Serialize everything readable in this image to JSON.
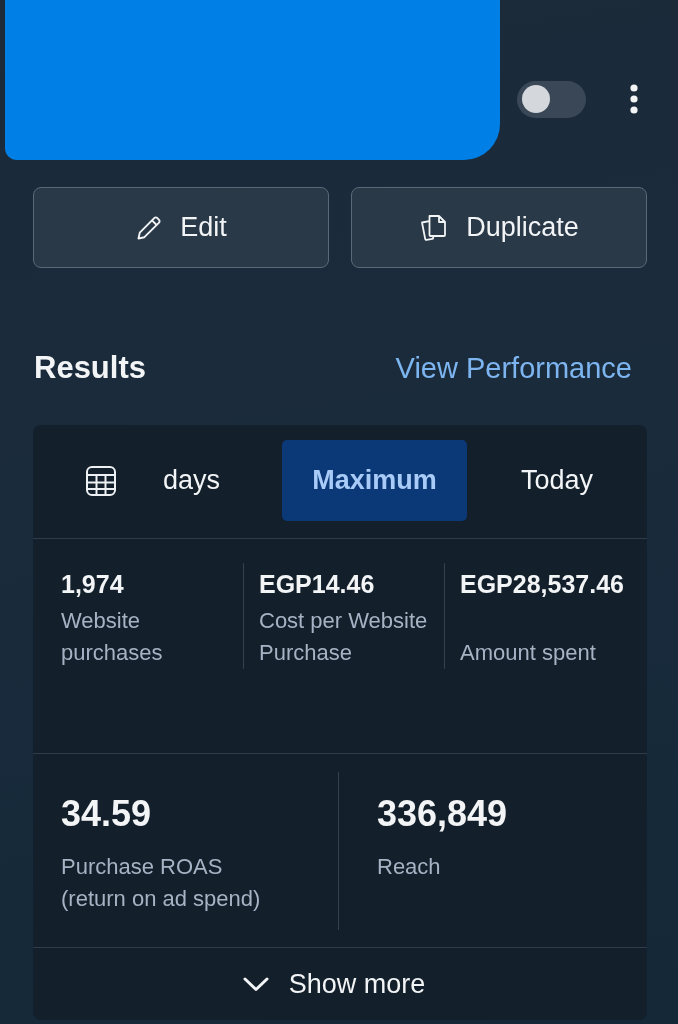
{
  "header": {
    "toggle": {
      "on": false
    }
  },
  "actions": [
    {
      "kind": "edit",
      "label": "Edit"
    },
    {
      "kind": "duplicate",
      "label": "Duplicate"
    }
  ],
  "results": {
    "title": "Results",
    "link": "View Performance"
  },
  "tabs": [
    {
      "kind": "date_range",
      "label": "days",
      "selected": false
    },
    {
      "kind": "preset",
      "label": "Maximum",
      "selected": true
    },
    {
      "kind": "preset",
      "label": "Today",
      "selected": false
    }
  ],
  "metric_rows": [
    [
      {
        "value": "1,974",
        "label": "Website purchases"
      },
      {
        "value": "EGP14.46",
        "label": "Cost per Website Purchase"
      },
      {
        "value": "EGP28,537.46",
        "label": "Amount spent"
      }
    ],
    [
      {
        "value": "34.59",
        "label": "Purchase ROAS (return on ad spend)"
      },
      {
        "value": "336,849",
        "label": "Reach"
      }
    ]
  ],
  "show_more": {
    "label": "Show more"
  }
}
